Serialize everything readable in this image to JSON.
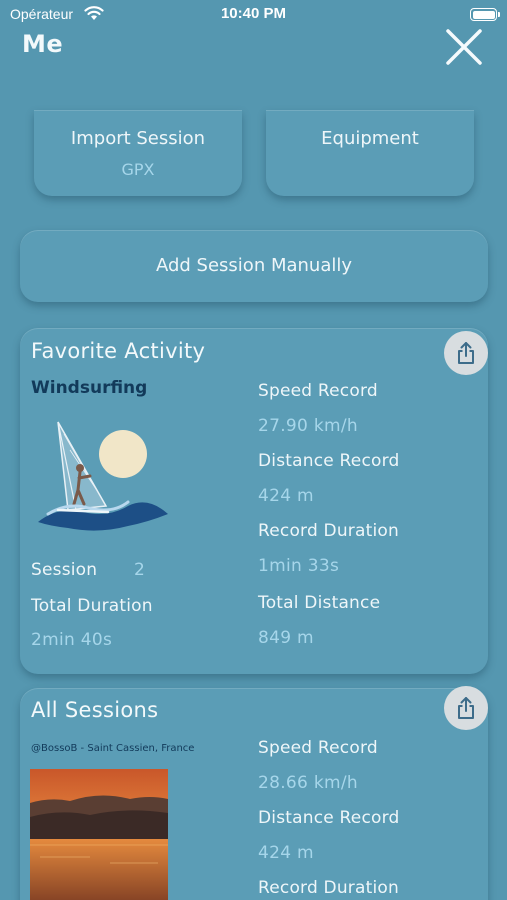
{
  "status_bar": {
    "carrier": "Opérateur",
    "time": "10:40 PM"
  },
  "header": {
    "title": "Me"
  },
  "actions": {
    "import_label": "Import Session",
    "import_sub": "GPX",
    "equipment_label": "Equipment",
    "add_manual_label": "Add Session Manually"
  },
  "favorite": {
    "title": "Favorite Activity",
    "activity": "Windsurfing",
    "session_label": "Session",
    "session_count": "2",
    "total_duration_label": "Total Duration",
    "total_duration": "2min 40s",
    "speed_record_label": "Speed Record",
    "speed_record": "27.90 km/h",
    "distance_record_label": "Distance Record",
    "distance_record": "424 m",
    "record_duration_label": "Record Duration",
    "record_duration": "1min 33s",
    "total_distance_label": "Total Distance",
    "total_distance": "849 m"
  },
  "all_sessions": {
    "title": "All Sessions",
    "photo_caption": "@BossoB - Saint Cassien, France",
    "speed_record_label": "Speed Record",
    "speed_record": "28.66 km/h",
    "distance_record_label": "Distance Record",
    "distance_record": "424 m",
    "record_duration_label": "Record Duration"
  },
  "icons": {
    "close": "close-icon",
    "share": "share-icon",
    "wifi": "wifi-icon",
    "battery": "battery-icon"
  },
  "colors": {
    "background": "#5597b0",
    "card": "#5b9db6",
    "value_text": "#a6d6ea",
    "accent_dark": "#123a5a"
  }
}
